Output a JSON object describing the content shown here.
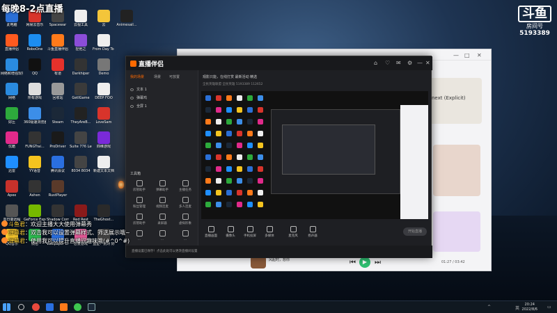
{
  "overlay": {
    "title": "每晚8-2点直播"
  },
  "douyu": {
    "logo": "斗鱼",
    "room_label": "房间号",
    "room_id": "5193389"
  },
  "desktop_icons": [
    {
      "label": "此电脑",
      "color": "#2a6fd6"
    },
    {
      "label": "网易云音乐",
      "color": "#d8342b"
    },
    {
      "label": "Spacewar",
      "color": "#444"
    },
    {
      "label": "云视工具",
      "color": "#eee"
    },
    {
      "label": "云",
      "color": "#f3c53a"
    },
    {
      "label": "Animesail...",
      "color": "#222"
    },
    {
      "label": "直播伴侣",
      "color": "#ff5a1f"
    },
    {
      "label": "RoboOne",
      "color": "#1c8df0"
    },
    {
      "label": "斗鱼直播伴侣",
      "color": "#ff7a1a"
    },
    {
      "label": "捏他之",
      "color": "#8b4dd8"
    },
    {
      "label": "From Day To Day",
      "color": "#eee"
    },
    {
      "label": "",
      "color": "#0000"
    },
    {
      "label": "网络和增强现实",
      "color": "#2a8be0"
    },
    {
      "label": "QQ",
      "color": "#111"
    },
    {
      "label": "有道",
      "color": "#e5312b"
    },
    {
      "label": "Darkhiper",
      "color": "#333"
    },
    {
      "label": "Demo",
      "color": "#777"
    },
    {
      "label": "",
      "color": "#0000"
    },
    {
      "label": "网络",
      "color": "#2a8be0"
    },
    {
      "label": "所有游戏",
      "color": "#ddd"
    },
    {
      "label": "回收站",
      "color": "#999"
    },
    {
      "label": "GetIGame",
      "color": "#3a3a3a"
    },
    {
      "label": "DEEP FOO",
      "color": "#eee"
    },
    {
      "label": "",
      "color": "#0000"
    },
    {
      "label": "好压",
      "color": "#2daa3c"
    },
    {
      "label": "360极速浏览器",
      "color": "#3c8ee8"
    },
    {
      "label": "Steam",
      "color": "#1b2838"
    },
    {
      "label": "TheyAreB...",
      "color": "#222"
    },
    {
      "label": "LoveSam",
      "color": "#d8342b"
    },
    {
      "label": "",
      "color": "#0000"
    },
    {
      "label": "优酷",
      "color": "#e02a8a"
    },
    {
      "label": "FUNGTrai...",
      "color": "#333"
    },
    {
      "label": "ProDriver",
      "color": "#1a1a1a"
    },
    {
      "label": "Suite 776 Launcher",
      "color": "#444"
    },
    {
      "label": "四维游戏",
      "color": "#7a2ad8"
    },
    {
      "label": "",
      "color": "#0000"
    },
    {
      "label": "迅雷",
      "color": "#1f8fff"
    },
    {
      "label": "YY语音",
      "color": "#f5c41f"
    },
    {
      "label": "腾讯会议",
      "color": "#2a6fe0"
    },
    {
      "label": "8034 8034",
      "color": "#444"
    },
    {
      "label": "新建文本文档",
      "color": "#eee"
    },
    {
      "label": "",
      "color": "#0000"
    },
    {
      "label": "Apex",
      "color": "#c7312b"
    },
    {
      "label": "Ashen",
      "color": "#333"
    },
    {
      "label": "RustPlayer",
      "color": "#5a3a2a"
    },
    {
      "label": "",
      "color": "#0000"
    },
    {
      "label": "",
      "color": "#0000"
    },
    {
      "label": "",
      "color": "#0000"
    },
    {
      "label": "向日葵远程",
      "color": "#555"
    },
    {
      "label": "GeForce Experience",
      "color": "#76b900"
    },
    {
      "label": "Shadow Corridor",
      "color": "#333"
    },
    {
      "label": "Red Rest",
      "color": "#8a1a1a"
    },
    {
      "label": "TheGhost...",
      "color": "#2a2a2a"
    },
    {
      "label": "",
      "color": "#0000"
    },
    {
      "label": "QQ音乐",
      "color": "#f6c72d"
    },
    {
      "label": "微信",
      "color": "#2dbf50"
    },
    {
      "label": "Wallpaper Engine:...",
      "color": "#2a6fe0"
    },
    {
      "label": "恋爱游戏",
      "color": "#e85a9a"
    },
    {
      "label": "蓝星：别对 好",
      "color": "#444"
    },
    {
      "label": "",
      "color": "#0000"
    }
  ],
  "music_window": {
    "explicit_label": "next (Explicit)",
    "song_title": "风起时，想你",
    "time": "01:27 / 03:42",
    "controls": {
      "prev": "⏮",
      "play": "▶",
      "next": "⏭"
    }
  },
  "streamer": {
    "logo": "直播伴侣",
    "tabs": [
      "我的场景",
      "场景",
      "可放置"
    ],
    "scenes": [
      "文本 1",
      "弹幕鸡",
      "全屏 1"
    ],
    "header_info": "观影只能，在线打赏 最新活动 精选",
    "sub_info": "全民英雄联盟  全民英雄  5193389  112652",
    "tools_title": "工具箱",
    "tools": [
      "房管助手",
      "弹幕助手",
      "主播任务",
      "粉丝管理",
      "视频连麦",
      "多人连麦",
      "房管助手",
      "录屏器",
      "虚拟形象",
      "…",
      "…",
      "…"
    ],
    "bottom_tools": [
      "直播画面",
      "摄像头",
      "手机投屏",
      "多媒体",
      "麦克风",
      "扬声器"
    ],
    "start_label": "开始直播",
    "status_msg": "直播设置已保存！点击此处可以更改直播间设置",
    "top_controls": [
      "⌂",
      "♡",
      "✉",
      "⚙",
      "—",
      "✕"
    ]
  },
  "chat": [
    {
      "name": "斗鱼君",
      "text": "欢迎主播大大使用弹幕秀"
    },
    {
      "name": "弹幕君",
      "text": "双击我可以设置弹幕样式、筛选展示哦~"
    },
    {
      "name": "弹幕君",
      "text": "使用我可以提升直播间趣味哦(#^0^#)"
    }
  ],
  "taskbar": {
    "time": "20:24",
    "date": "2022/8/6",
    "lang": "英"
  }
}
